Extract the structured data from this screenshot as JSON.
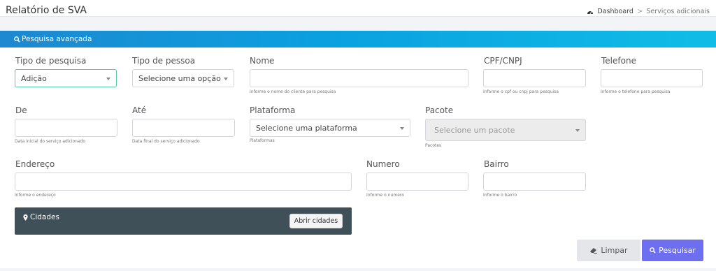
{
  "header": {
    "title": "Relatório de SVA",
    "breadcrumb": {
      "home": "Dashboard",
      "separator": ">",
      "current": "Serviços adicionais"
    }
  },
  "panel": {
    "title": "Pesquisa avançada",
    "icon": "search-icon"
  },
  "form": {
    "tipo_pesquisa": {
      "label": "Tipo de pesquisa",
      "value": "Adição"
    },
    "tipo_pessoa": {
      "label": "Tipo de pessoa",
      "value": "Selecione uma opção"
    },
    "nome": {
      "label": "Nome",
      "value": "",
      "help": "Informe o nome do cliente para pesquisa"
    },
    "cpf_cnpj": {
      "label": "CPF/CNPJ",
      "value": "",
      "help": "Informe o cpf ou cnpj para pesquisa"
    },
    "telefone": {
      "label": "Telefone",
      "value": "",
      "help": "Informe o telefone para pesquisa"
    },
    "de": {
      "label": "De",
      "value": "",
      "help": "Data inicial do serviço adicionado"
    },
    "ate": {
      "label": "Até",
      "value": "",
      "help": "Data final do serviço adicionado"
    },
    "plataforma": {
      "label": "Plataforma",
      "value": "Selecione uma plataforma",
      "help": "Plataformas"
    },
    "pacote": {
      "label": "Pacote",
      "value": "Selecione um pacote",
      "help": "Pacotes",
      "disabled": true
    },
    "endereco": {
      "label": "Endereço",
      "value": "",
      "help": "Informe o endereço"
    },
    "numero": {
      "label": "Numero",
      "value": "",
      "help": "Informe o numero"
    },
    "bairro": {
      "label": "Bairro",
      "value": "",
      "help": "Informe o bairro"
    }
  },
  "cidades": {
    "label": "Cidades",
    "icon": "map-pin-icon",
    "button": "Abrir cidades"
  },
  "actions": {
    "limpar": {
      "label": "Limpar",
      "icon": "eraser-icon"
    },
    "pesquisar": {
      "label": "Pesquisar",
      "icon": "search-icon"
    }
  },
  "colors": {
    "header_gradient_start": "#1e88d0",
    "header_gradient_end": "#10bde6",
    "cidades_bg": "#3f5058",
    "pesquisar_bg": "#6d6ff0",
    "limpar_bg": "#e4e6ea",
    "active_border": "#52c9a8"
  }
}
